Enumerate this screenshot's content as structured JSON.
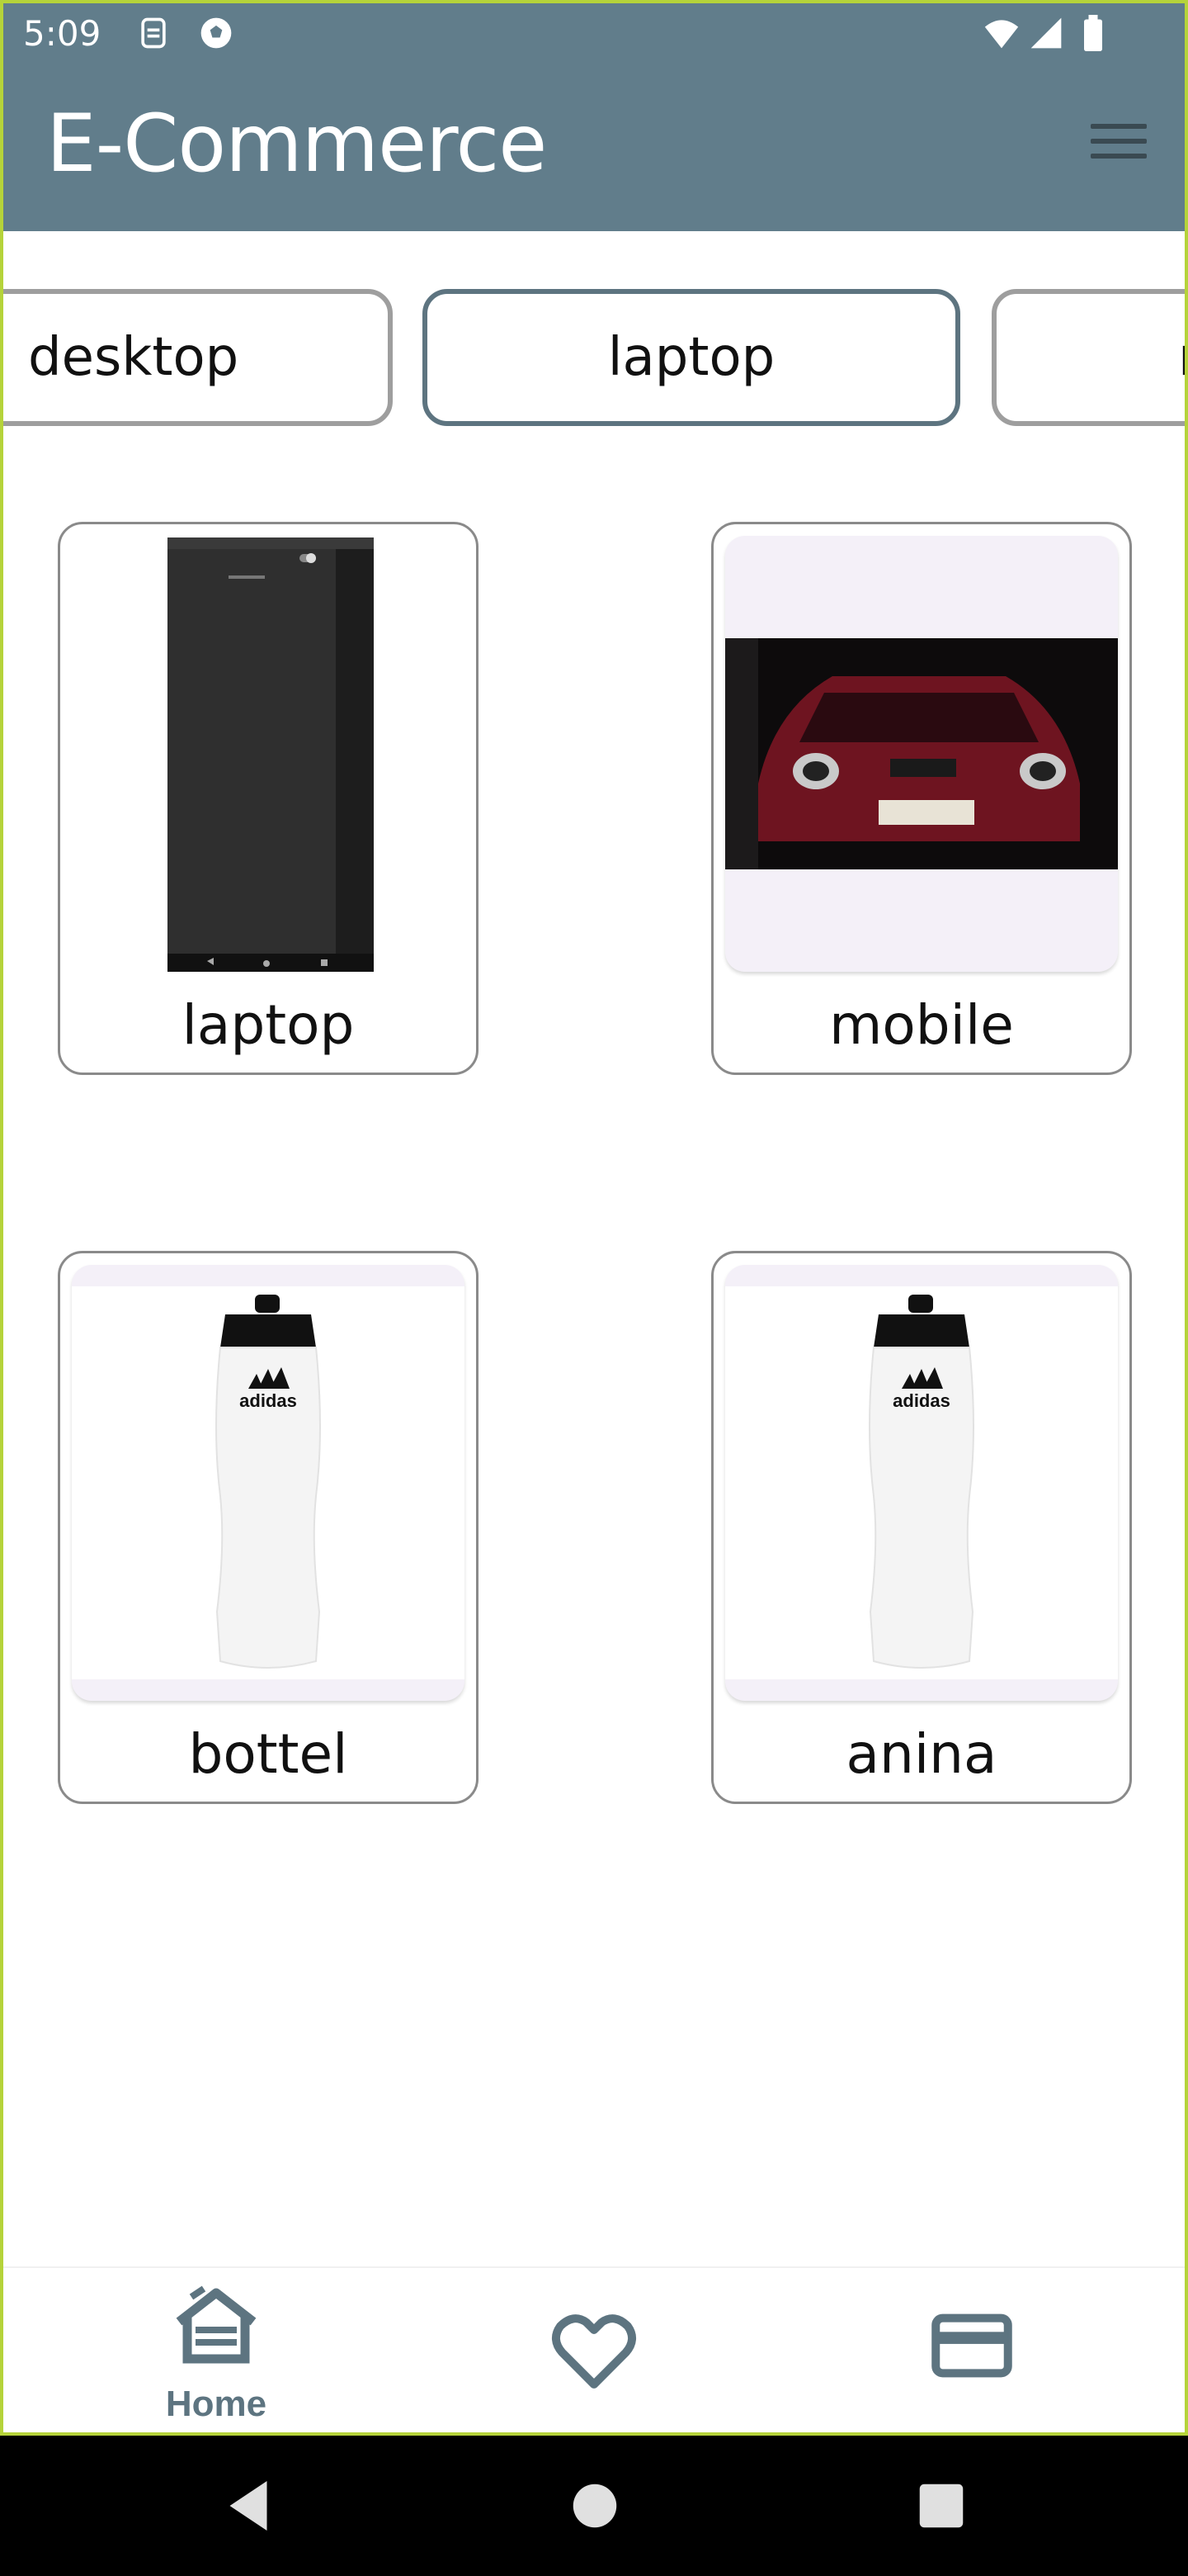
{
  "status_bar": {
    "time": "5:09",
    "icons": [
      "sim-icon",
      "soccer-ball-icon",
      "wifi-icon",
      "signal-icon",
      "battery-icon"
    ]
  },
  "app_bar": {
    "title": "E-Commerce",
    "menu_icon": "hamburger-menu-icon"
  },
  "categories": [
    {
      "label": "desktop",
      "selected": false
    },
    {
      "label": "laptop",
      "selected": true
    },
    {
      "label": "m",
      "selected": false
    }
  ],
  "products": [
    {
      "name": "laptop",
      "image": "phone-screenshot-dark"
    },
    {
      "name": "mobile",
      "image": "red-car-photo"
    },
    {
      "name": "bottel",
      "image": "white-water-bottle"
    },
    {
      "name": "anina",
      "image": "white-water-bottle"
    }
  ],
  "bottom_nav": {
    "items": [
      {
        "label": "Home",
        "icon": "home-icon"
      },
      {
        "icon": "heart-icon"
      },
      {
        "icon": "card-icon"
      }
    ]
  },
  "system_nav": [
    "back-icon",
    "home-circle-icon",
    "recents-icon"
  ],
  "colors": {
    "primary": "#617d8b",
    "active_chip_border": "#5d7480",
    "frame": "#b5d33a"
  }
}
